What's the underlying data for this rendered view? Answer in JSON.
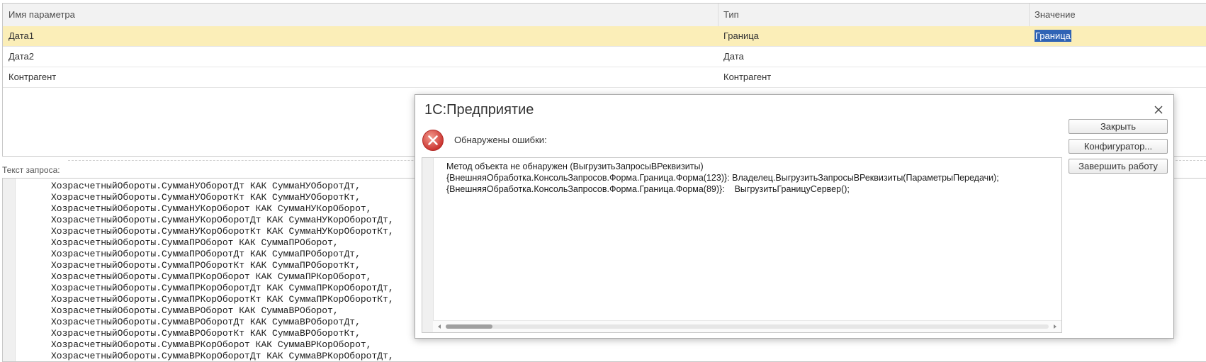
{
  "params_table": {
    "columns": [
      "Имя параметра",
      "Тип",
      "Значение"
    ],
    "rows": [
      {
        "name": "Дата1",
        "type": "Граница",
        "value": "Граница"
      },
      {
        "name": "Дата2",
        "type": "Дата",
        "value": ""
      },
      {
        "name": "Контрагент",
        "type": "Контрагент",
        "value": ""
      }
    ]
  },
  "query": {
    "label": "Текст запроса:",
    "lines": [
      "ХозрасчетныйОбороты.СуммаНУОборотДт КАК СуммаНУОборотДт,",
      "ХозрасчетныйОбороты.СуммаНУОборотКт КАК СуммаНУОборотКт,",
      "ХозрасчетныйОбороты.СуммаНУКорОборот КАК СуммаНУКорОборот,",
      "ХозрасчетныйОбороты.СуммаНУКорОборотДт КАК СуммаНУКорОборотДт,",
      "ХозрасчетныйОбороты.СуммаНУКорОборотКт КАК СуммаНУКорОборотКт,",
      "ХозрасчетныйОбороты.СуммаПРОборот КАК СуммаПРОборот,",
      "ХозрасчетныйОбороты.СуммаПРОборотДт КАК СуммаПРОборотДт,",
      "ХозрасчетныйОбороты.СуммаПРОборотКт КАК СуммаПРОборотКт,",
      "ХозрасчетныйОбороты.СуммаПРКорОборот КАК СуммаПРКорОборот,",
      "ХозрасчетныйОбороты.СуммаПРКорОборотДт КАК СуммаПРКорОборотДт,",
      "ХозрасчетныйОбороты.СуммаПРКорОборотКт КАК СуммаПРКорОборотКт,",
      "ХозрасчетныйОбороты.СуммаВРОборот КАК СуммаВРОборот,",
      "ХозрасчетныйОбороты.СуммаВРОборотДт КАК СуммаВРОборотДт,",
      "ХозрасчетныйОбороты.СуммаВРОборотКт КАК СуммаВРОборотКт,",
      "ХозрасчетныйОбороты.СуммаВРКорОборот КАК СуммаВРКорОборот,",
      "ХозрасчетныйОбороты.СуммаВРКорОборотДт КАК СуммаВРКорОборотДт,"
    ]
  },
  "dialog": {
    "title": "1С:Предприятие",
    "close_icon": "close-icon",
    "error_icon": "error-icon",
    "heading": "Обнаружены ошибки:",
    "message_lines": [
      "Метод объекта не обнаружен (ВыгрузитьЗапросыВРеквизиты)",
      "{ВнешняяОбработка.КонсольЗапросов.Форма.Граница.Форма(123)}: Владелец.ВыгрузитьЗапросыВРеквизиты(ПараметрыПередачи);",
      "{ВнешняяОбработка.КонсольЗапросов.Форма.Граница.Форма(89)}:    ВыгрузитьГраницуСервер();"
    ],
    "buttons": [
      "Закрыть",
      "Конфигуратор...",
      "Завершить работу"
    ]
  },
  "colors": {
    "selected_row": "#fbeeb8",
    "selection_highlight": "#2f63b5",
    "error_red": "#d9534f"
  }
}
